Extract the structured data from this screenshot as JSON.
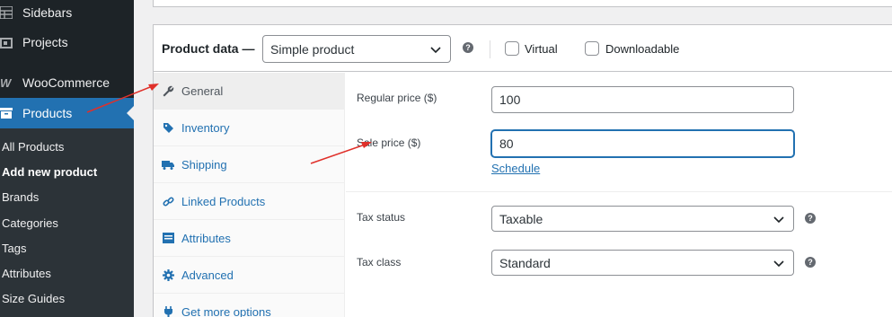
{
  "sidebar": {
    "top_items": [
      {
        "label": "Sidebars",
        "icon": "grid-icon"
      },
      {
        "label": "Projects",
        "icon": "portfolio-icon"
      },
      {
        "label": "WooCommerce",
        "icon": "woocommerce-icon"
      },
      {
        "label": "Products",
        "icon": "archive-icon"
      }
    ],
    "submenu": [
      "All Products",
      "Add new product",
      "Brands",
      "Categories",
      "Tags",
      "Attributes",
      "Size Guides"
    ]
  },
  "product_data": {
    "title": "Product data —",
    "type_value": "Simple product",
    "help": "?",
    "virtual_label": "Virtual",
    "downloadable_label": "Downloadable"
  },
  "tabs": [
    {
      "label": "General",
      "icon": "wrench-icon"
    },
    {
      "label": "Inventory",
      "icon": "tag-icon"
    },
    {
      "label": "Shipping",
      "icon": "truck-icon"
    },
    {
      "label": "Linked Products",
      "icon": "link-icon"
    },
    {
      "label": "Attributes",
      "icon": "list-icon"
    },
    {
      "label": "Advanced",
      "icon": "gear-icon"
    },
    {
      "label": "Get more options",
      "icon": "plugin-icon"
    }
  ],
  "general": {
    "regular_price_label": "Regular price ($)",
    "regular_price_value": "100",
    "sale_price_label": "Sale price ($)",
    "sale_price_value": "80",
    "schedule_link": "Schedule",
    "tax_status_label": "Tax status",
    "tax_status_value": "Taxable",
    "tax_class_label": "Tax class",
    "tax_class_value": "Standard"
  },
  "colors": {
    "admin_bg": "#1d2327",
    "accent": "#2271b1",
    "annotation": "#e0302a"
  }
}
